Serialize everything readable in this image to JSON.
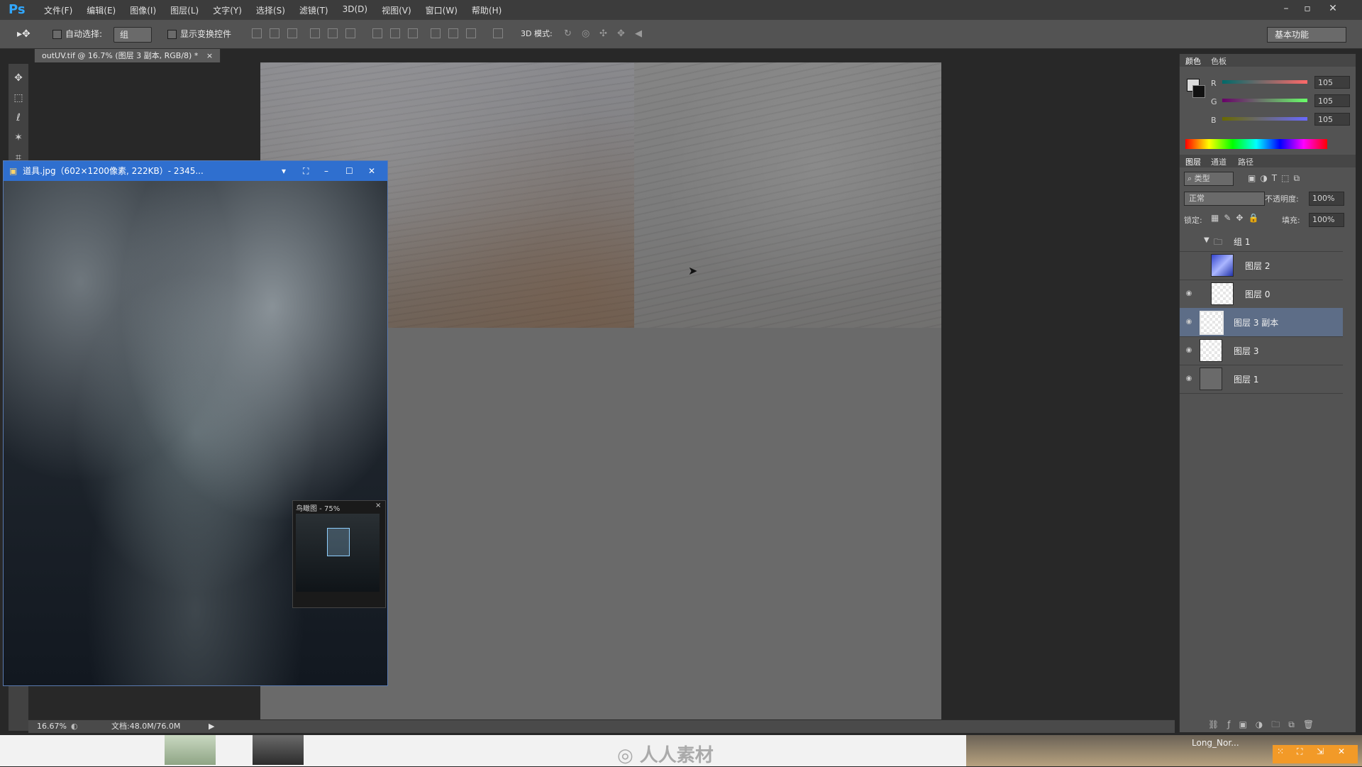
{
  "menubar": {
    "logo": "Ps",
    "items": [
      "文件(F)",
      "编辑(E)",
      "图像(I)",
      "图层(L)",
      "文字(Y)",
      "选择(S)",
      "滤镜(T)",
      "3D(D)",
      "视图(V)",
      "窗口(W)",
      "帮助(H)"
    ]
  },
  "optbar": {
    "auto_select_label": "自动选择:",
    "auto_select_value": "组",
    "show_transform_label": "显示变换控件",
    "mode3d_label": "3D 模式:",
    "workspace": "基本功能"
  },
  "document": {
    "tab_title": "outUV.tif @ 16.7% (图层 3 副本, RGB/8) *",
    "zoom": "16.67%",
    "doc_size": "文档:48.0M/76.0M"
  },
  "color_panel": {
    "tabs": [
      "颜色",
      "色板"
    ],
    "r_label": "R",
    "g_label": "G",
    "b_label": "B",
    "r": "105",
    "g": "105",
    "b": "105"
  },
  "layers_panel": {
    "tabs": [
      "图层",
      "通道",
      "路径"
    ],
    "filter": "类型",
    "blend_mode": "正常",
    "opacity_label": "不透明度:",
    "opacity": "100%",
    "lock_label": "锁定:",
    "fill_label": "填充:",
    "fill": "100%",
    "group_name": "组 1",
    "layers": [
      {
        "name": "图层 2",
        "visible": false,
        "selected": false,
        "in_group": true
      },
      {
        "name": "图层 0",
        "visible": false,
        "selected": false,
        "in_group": true
      },
      {
        "name": "图层 3 副本",
        "visible": true,
        "selected": true,
        "in_group": false
      },
      {
        "name": "图层 3",
        "visible": true,
        "selected": false,
        "in_group": false
      },
      {
        "name": "图层 1",
        "visible": true,
        "selected": false,
        "in_group": false
      }
    ]
  },
  "viewer": {
    "title": "道具.jpg（602×1200像素, 222KB）- 2345...",
    "minimap_label": "鸟瞰图 - 75%"
  },
  "taskbar": {
    "watermark": "人人素材",
    "user_label": "Long_Nor..."
  },
  "colors": {
    "accent": "#2f6fcf",
    "selected_layer": "#5d6d87",
    "panel_bg": "#535353"
  }
}
